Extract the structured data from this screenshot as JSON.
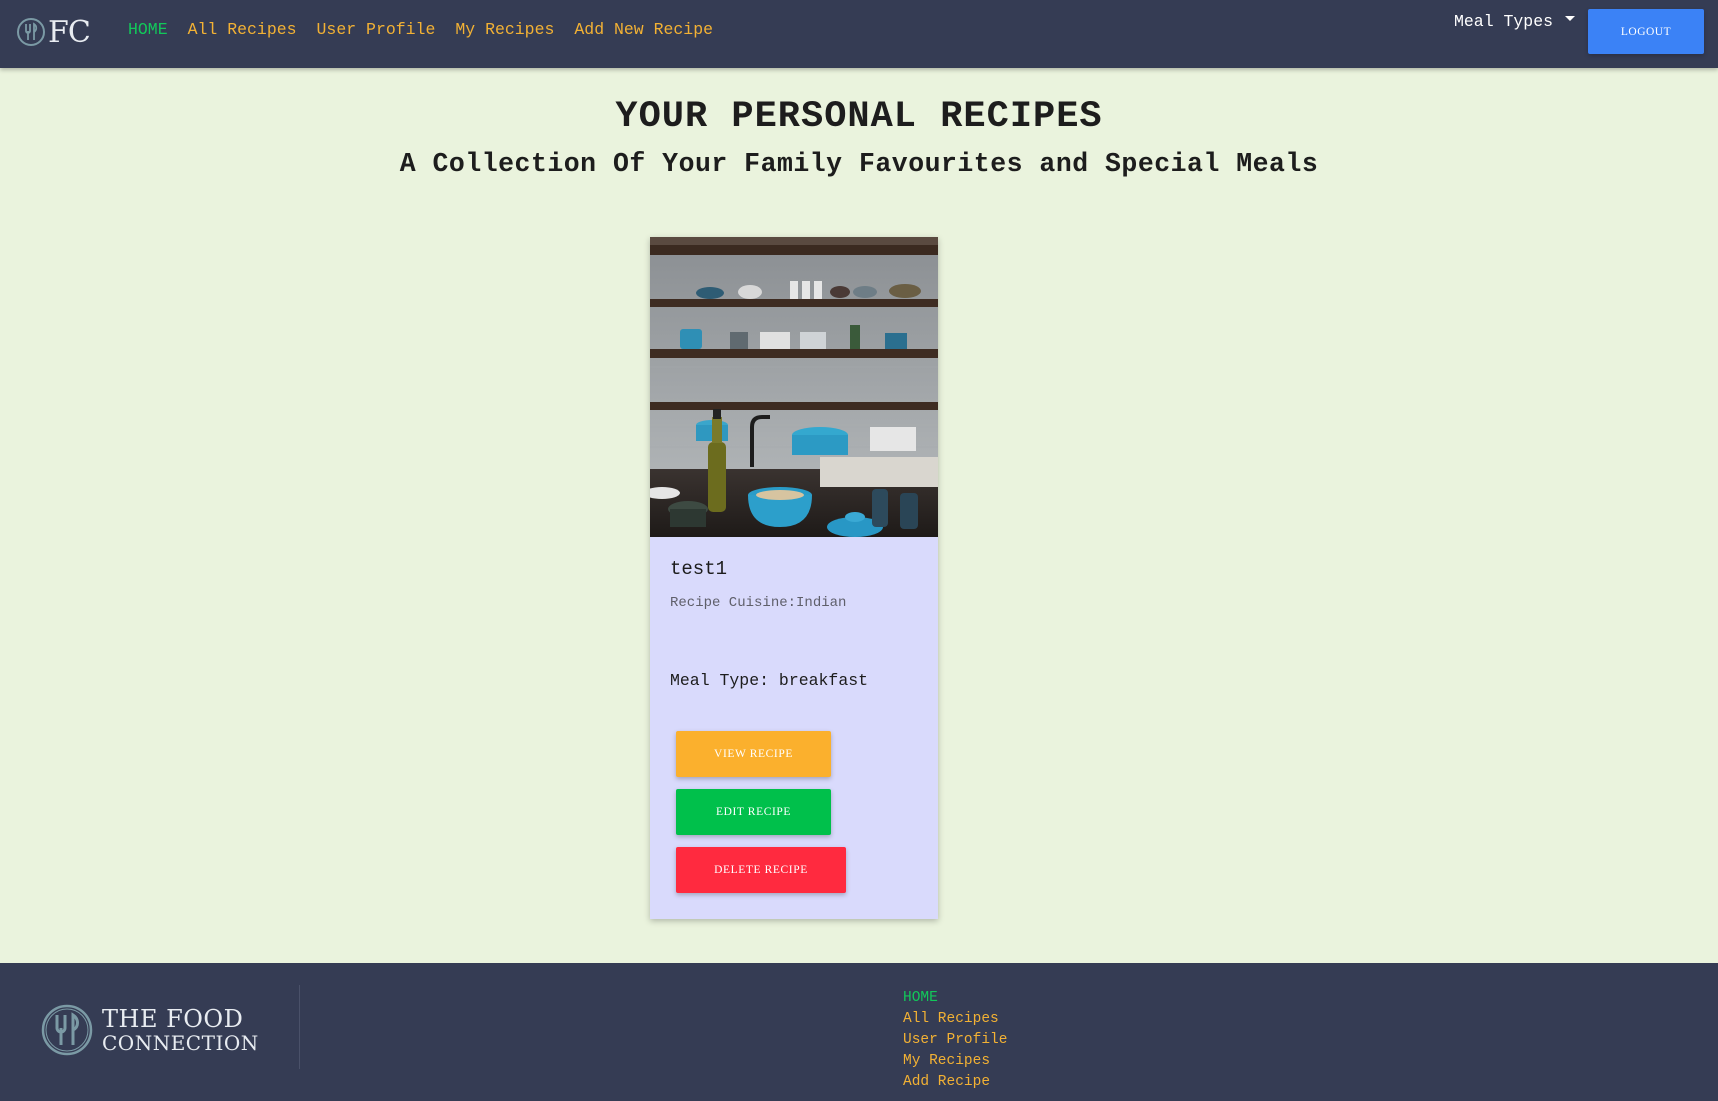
{
  "nav": {
    "logo_text": "FC",
    "links": [
      {
        "label": "HOME",
        "active": true
      },
      {
        "label": "All Recipes"
      },
      {
        "label": "User Profile"
      },
      {
        "label": "My Recipes"
      },
      {
        "label": "Add New Recipe"
      }
    ],
    "meal_types_label": "Meal Types",
    "logout_label": "LOGOUT"
  },
  "page": {
    "title": "YOUR PERSONAL RECIPES",
    "subtitle": "A Collection Of Your Family Favourites and Special Meals"
  },
  "recipe": {
    "name": "test1",
    "cuisine": "Recipe Cuisine:Indian",
    "meal_type": "Meal Type: breakfast",
    "view_label": "VIEW RECIPE",
    "edit_label": "EDIT RECIPE",
    "delete_label": "DELETE RECIPE"
  },
  "footer": {
    "logo_line1": "THE FOOD",
    "logo_line2": "CONNECTION",
    "links": [
      {
        "label": "HOME",
        "active": true
      },
      {
        "label": "All Recipes"
      },
      {
        "label": "User Profile"
      },
      {
        "label": "My Recipes"
      },
      {
        "label": "Add Recipe"
      }
    ]
  },
  "colors": {
    "navbar_bg": "#353c54",
    "page_bg": "#eaf3dd",
    "card_bg": "#d9dafc",
    "link_color": "#f2b134",
    "active_link": "#12c85a",
    "logout_bg": "#3b82f6",
    "view_bg": "#fbb02d",
    "edit_bg": "#00c04b",
    "delete_bg": "#ff2a3f"
  },
  "icons": {
    "nav_logo": "fork-knife-logo-icon",
    "footer_logo": "fork-knife-logo-icon",
    "meal_types_caret": "caret-down-icon"
  }
}
